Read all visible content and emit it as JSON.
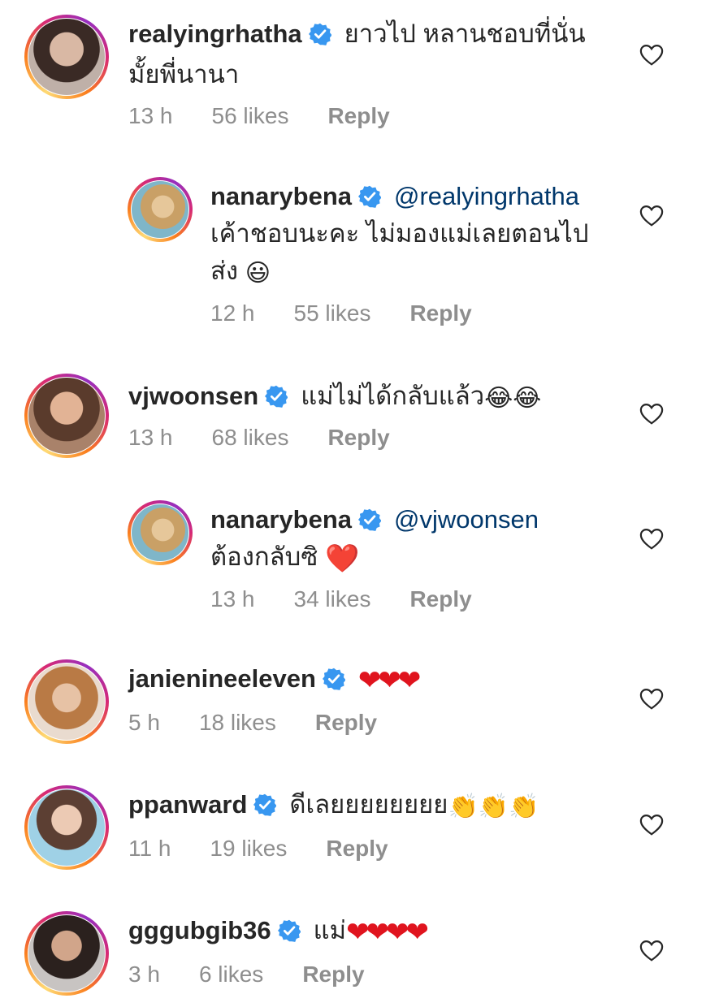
{
  "comments": [
    {
      "username": "realyingrhatha",
      "text_line1": "ยาวไป หลานชอบที่นั่น",
      "text_line2": "มั้ยพี่นานา",
      "time": "13 h",
      "likes": "56 likes",
      "reply": "Reply"
    },
    {
      "username": "nanarybena",
      "mention": "@realyingrhatha",
      "text_line1": "เค้าชอบนะคะ ไม่มองแม่เลยตอนไป",
      "text_line2": "ส่ง",
      "emoji": "😃",
      "time": "12 h",
      "likes": "55 likes",
      "reply": "Reply"
    },
    {
      "username": "vjwoonsen",
      "text_line1": "แม่ไม่ได้กลับแล้ว",
      "emoji": "😂😂",
      "time": "13 h",
      "likes": "68 likes",
      "reply": "Reply"
    },
    {
      "username": "nanarybena",
      "mention": "@vjwoonsen",
      "text_line1": "ต้องกลับซิ",
      "emoji": "❤️",
      "time": "13 h",
      "likes": "34 likes",
      "reply": "Reply"
    },
    {
      "username": "janienineeleven",
      "emoji": "❤❤❤",
      "time": "5 h",
      "likes": "18 likes",
      "reply": "Reply"
    },
    {
      "username": "ppanward",
      "text_line1": "ดีเลยยยยยยยย",
      "emoji": "👏👏👏",
      "time": "11 h",
      "likes": "19 likes",
      "reply": "Reply"
    },
    {
      "username": "gggubgib36",
      "text_line1": "แม่",
      "emoji": "❤❤❤❤",
      "time": "3 h",
      "likes": "6 likes",
      "reply": "Reply"
    }
  ],
  "colors": {
    "verified": "#3897f0",
    "mention": "#00376b",
    "meta": "#8e8e8e",
    "heart_red": "#e0141e"
  },
  "icons": {
    "verified": "verified-badge-icon",
    "like": "heart-outline-icon"
  }
}
